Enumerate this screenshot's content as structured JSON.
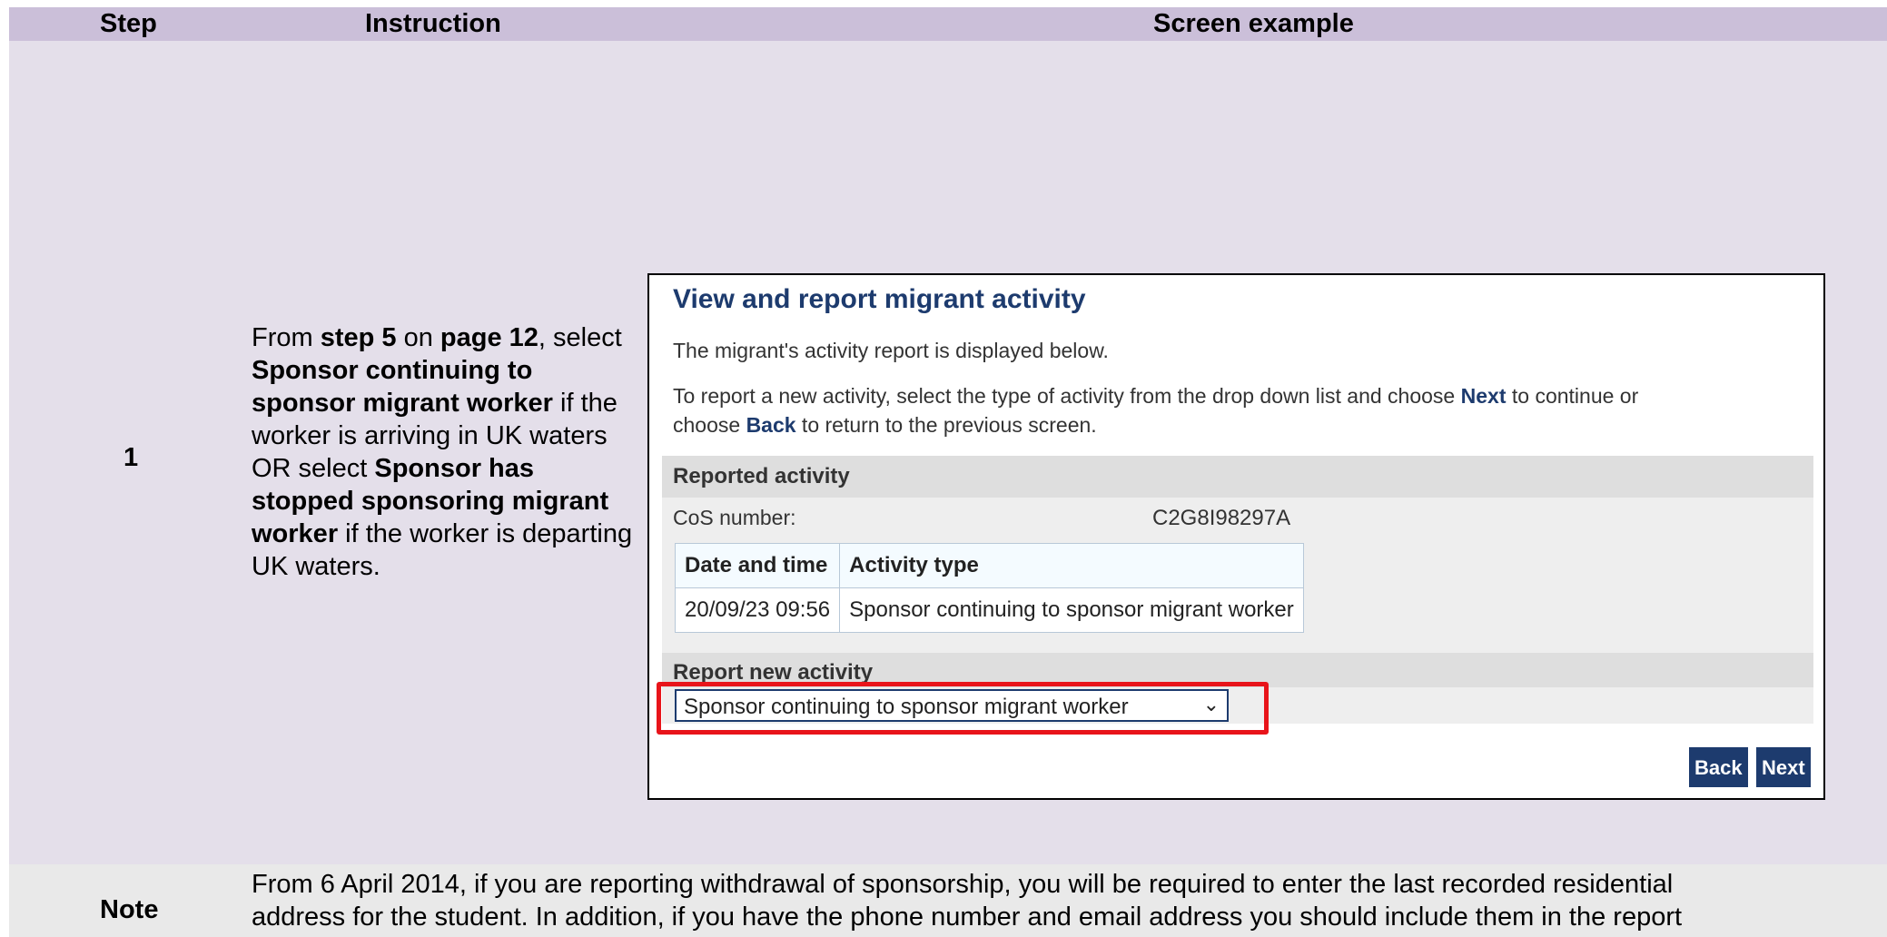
{
  "table": {
    "headers": {
      "step": "Step",
      "instruction": "Instruction",
      "screen": "Screen example"
    }
  },
  "step": {
    "number": "1",
    "instruction": {
      "t1": "From ",
      "b1": "step 5",
      "t2": " on ",
      "b2": "page 12",
      "t3": ", select ",
      "b3": "Sponsor continuing to sponsor migrant worker",
      "t4": " if the worker is arriving in UK waters OR select ",
      "b4": "Sponsor has stopped sponsoring migrant worker",
      "t5": " if the worker is departing UK waters."
    }
  },
  "screen": {
    "title": "View and report migrant activity",
    "intro": "The migrant's activity report is displayed below.",
    "instruction_part1": "To report a new activity, select the type of activity from the drop down list and choose ",
    "instruction_next": "Next",
    "instruction_part2": " to continue or",
    "instruction_part3": "choose ",
    "instruction_back": "Back",
    "instruction_part4": " to return to the previous screen.",
    "reported_heading": "Reported activity",
    "cos_label": "CoS number:",
    "cos_value": "C2G8I98297A",
    "activity_table": {
      "headers": [
        "Date and time",
        "Activity type"
      ],
      "rows": [
        [
          "20/09/23 09:56",
          "Sponsor continuing to sponsor migrant worker"
        ]
      ]
    },
    "report_new_heading": "Report new activity",
    "select_value": "Sponsor continuing to sponsor migrant worker",
    "back_label": "Back",
    "next_label": "Next",
    "highlight_color": "#e8141a",
    "accent_color": "#1d3b6e"
  },
  "note": {
    "label": "Note",
    "line1": "From 6 April 2014, if you are reporting withdrawal of sponsorship, you will be required to enter the last recorded residential",
    "line2": "address for the student. In addition, if you have the phone number and email address you should include them in the report"
  }
}
